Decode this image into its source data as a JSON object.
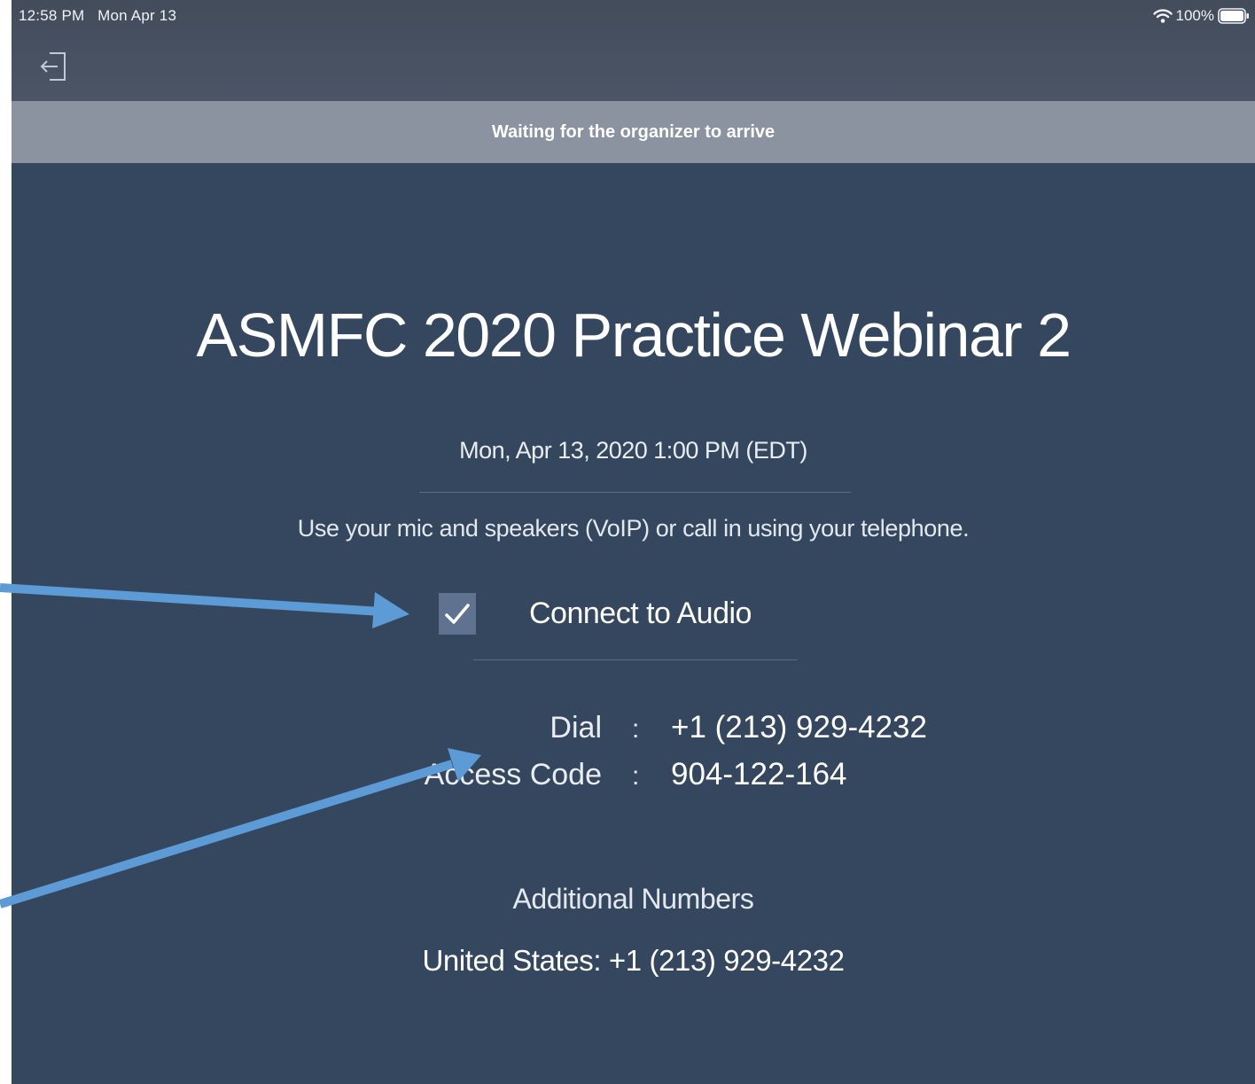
{
  "status_bar": {
    "time": "12:58 PM",
    "date": "Mon Apr 13",
    "battery": "100%"
  },
  "nav": {
    "exit_icon": "exit-icon"
  },
  "banner": {
    "text": "Waiting for the organizer to arrive"
  },
  "meeting": {
    "title": "ASMFC 2020 Practice Webinar 2",
    "datetime": "Mon, Apr 13, 2020 1:00 PM (EDT)",
    "instructions": "Use your mic and speakers (VoIP) or call in using your telephone."
  },
  "audio": {
    "checkbox_checked": true,
    "label": "Connect to Audio"
  },
  "call_info": {
    "separator": ":",
    "dial_label": "Dial",
    "dial_value": "+1 (213) 929-4232",
    "access_label": "Access Code",
    "access_value": "904-122-164"
  },
  "additional": {
    "heading": "Additional Numbers",
    "line": "United States: +1 (213) 929-4232"
  },
  "colors": {
    "background": "#35475e",
    "banner": "#8c93a0",
    "checkbox": "#5f7290",
    "annotation_arrow": "#5c9bd6"
  }
}
